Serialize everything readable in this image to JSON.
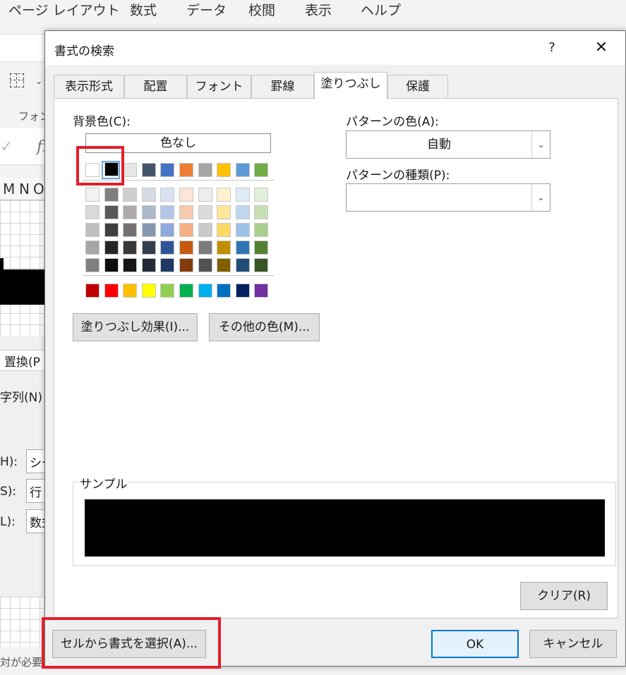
{
  "background": {
    "ribbon_tabs": [
      "ページ レイアウト",
      "数式",
      "データ",
      "校閲",
      "表示",
      "ヘルプ"
    ],
    "font_group_label": "フォン",
    "columns": [
      "M",
      "N",
      "O"
    ],
    "replace_tab_label": "置換(P",
    "search_string_label": "字列(N)",
    "rows": [
      {
        "label": "H):",
        "value": "シー"
      },
      {
        "label": "S):",
        "value": "行"
      },
      {
        "label": "L):",
        "value": "数式"
      }
    ],
    "status_text": "対が必要"
  },
  "dialog": {
    "title": "書式の検索",
    "help": "?",
    "close": "✕",
    "tabs": [
      "表示形式",
      "配置",
      "フォント",
      "罫線",
      "塗りつぶし",
      "保護"
    ],
    "active_tab": "塗りつぶし",
    "background_color_label": "背景色(C):",
    "no_color_label": "色なし",
    "theme_colors": [
      [
        "#FFFFFF",
        "#000000",
        "#E7E6E6",
        "#44546A",
        "#4472C4",
        "#ED7D31",
        "#A5A5A5",
        "#FFC000",
        "#5B9BD5",
        "#70AD47"
      ],
      [
        "#F2F2F2",
        "#7F7F7F",
        "#D0CECE",
        "#D6DCE4",
        "#D9E1F2",
        "#FCE4D6",
        "#EDEDED",
        "#FFF2CC",
        "#DDEBF7",
        "#E2EFDA"
      ],
      [
        "#D9D9D9",
        "#595959",
        "#AEAAAA",
        "#ACB9CA",
        "#B4C6E7",
        "#F8CBAD",
        "#DBDBDB",
        "#FFE699",
        "#BDD7EE",
        "#C6E0B4"
      ],
      [
        "#BFBFBF",
        "#404040",
        "#757171",
        "#8497B0",
        "#8EA9DB",
        "#F4B084",
        "#C9C9C9",
        "#FFD966",
        "#9BC2E6",
        "#A9D08E"
      ],
      [
        "#A6A6A6",
        "#262626",
        "#3A3838",
        "#333F4F",
        "#2F5597",
        "#C65911",
        "#7B7B7B",
        "#BF8F00",
        "#2E75B6",
        "#548235"
      ],
      [
        "#808080",
        "#0D0D0D",
        "#161616",
        "#222B35",
        "#1F3864",
        "#833C0C",
        "#525252",
        "#806000",
        "#1F4E78",
        "#375623"
      ]
    ],
    "standard_colors": [
      "#C00000",
      "#FF0000",
      "#FFC000",
      "#FFFF00",
      "#92D050",
      "#00B050",
      "#00B0F0",
      "#0070C0",
      "#002060",
      "#7030A0"
    ],
    "selected_color": "#000000",
    "fill_effects_button": "塗りつぶし効果(I)...",
    "more_colors_button": "その他の色(M)...",
    "pattern_color_label": "パターンの色(A):",
    "pattern_color_value": "自動",
    "pattern_style_label": "パターンの種類(P):",
    "pattern_style_value": "",
    "sample_label": "サンプル",
    "sample_color": "#000000",
    "clear_button": "クリア(R)",
    "choose_from_cell_button": "セルから書式を選択(A)...",
    "ok_button": "OK",
    "cancel_button": "キャンセル",
    "highlight_color": "#E0202B"
  }
}
